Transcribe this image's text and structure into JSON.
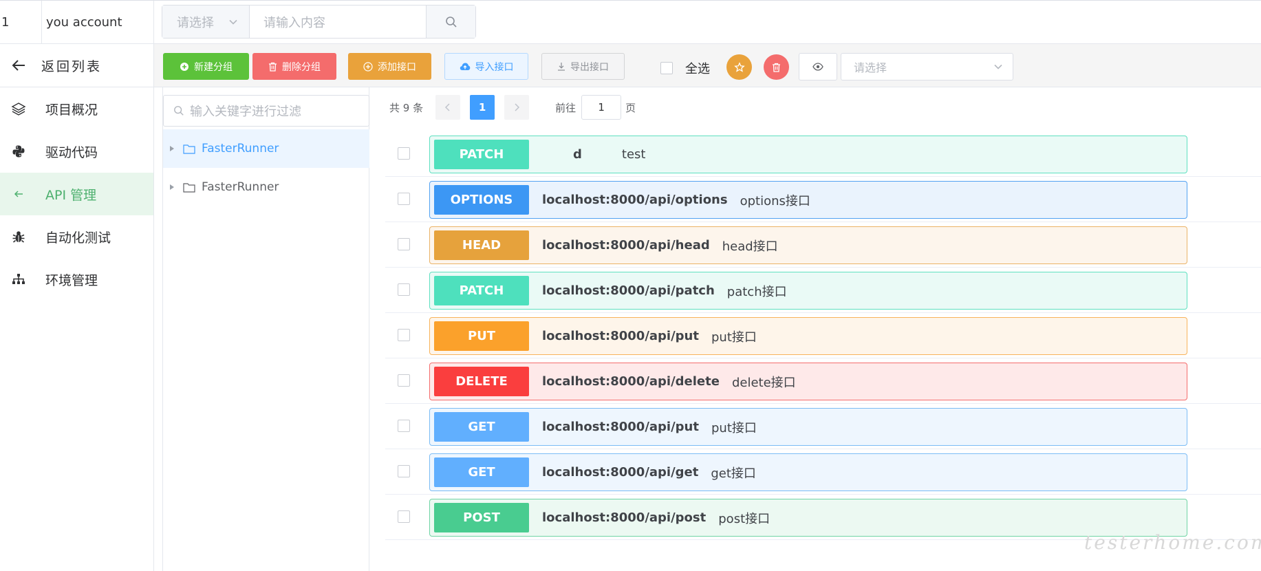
{
  "topbar": {
    "user_id": "1",
    "account": "you account",
    "search_select_placeholder": "请选择",
    "search_input_placeholder": "请输入内容"
  },
  "sidebar": {
    "back_label": "返回列表",
    "items": [
      {
        "label": "项目概况",
        "icon": "layers-icon"
      },
      {
        "label": "驱动代码",
        "icon": "python-icon"
      },
      {
        "label": "API 管理",
        "icon": "api-icon",
        "active": true
      },
      {
        "label": "自动化测试",
        "icon": "bug-icon"
      },
      {
        "label": "环境管理",
        "icon": "sitemap-icon"
      }
    ]
  },
  "toolbar": {
    "new_group": "新建分组",
    "delete_group": "删除分组",
    "add_api": "添加接口",
    "import_api": "导入接口",
    "export_api": "导出接口",
    "select_all": "全选",
    "filter_placeholder": "请选择"
  },
  "tree": {
    "filter_placeholder": "输入关键字进行过滤",
    "nodes": [
      {
        "label": "FasterRunner",
        "selected": true
      },
      {
        "label": "FasterRunner",
        "selected": false
      }
    ]
  },
  "pager": {
    "total": "共 9 条",
    "current_page": "1",
    "goto_prefix": "前往",
    "goto_value": "1",
    "goto_suffix": "页"
  },
  "colors": {
    "PATCH": {
      "badge": "#4ee0bd",
      "bg": "#eafaf6",
      "border": "#5ee0c0"
    },
    "OPTIONS": {
      "badge": "#3c97f4",
      "bg": "#eaf3fd",
      "border": "#52a2f2"
    },
    "HEAD": {
      "badge": "#e6a23c",
      "bg": "#fdf5ec",
      "border": "#eab367"
    },
    "PUT": {
      "badge": "#fba12b",
      "bg": "#fef5ea",
      "border": "#f8b35a"
    },
    "DELETE": {
      "badge": "#fa3e3e",
      "bg": "#fee9e9",
      "border": "#f46b6b"
    },
    "GET": {
      "badge": "#61affe",
      "bg": "#eef6fe",
      "border": "#7bbcf5"
    },
    "POST": {
      "badge": "#49cc90",
      "bg": "#ecf9f2",
      "border": "#6fd4a4"
    }
  },
  "apis": [
    {
      "method": "PATCH",
      "url": "d",
      "name": "test"
    },
    {
      "method": "OPTIONS",
      "url": "localhost:8000/api/options",
      "name": "options接口"
    },
    {
      "method": "HEAD",
      "url": "localhost:8000/api/head",
      "name": "head接口"
    },
    {
      "method": "PATCH",
      "url": "localhost:8000/api/patch",
      "name": "patch接口"
    },
    {
      "method": "PUT",
      "url": "localhost:8000/api/put",
      "name": "put接口"
    },
    {
      "method": "DELETE",
      "url": "localhost:8000/api/delete",
      "name": "delete接口"
    },
    {
      "method": "GET",
      "url": "localhost:8000/api/put",
      "name": "put接口"
    },
    {
      "method": "GET",
      "url": "localhost:8000/api/get",
      "name": "get接口"
    },
    {
      "method": "POST",
      "url": "localhost:8000/api/post",
      "name": "post接口"
    }
  ],
  "watermark": "testerhome.com"
}
